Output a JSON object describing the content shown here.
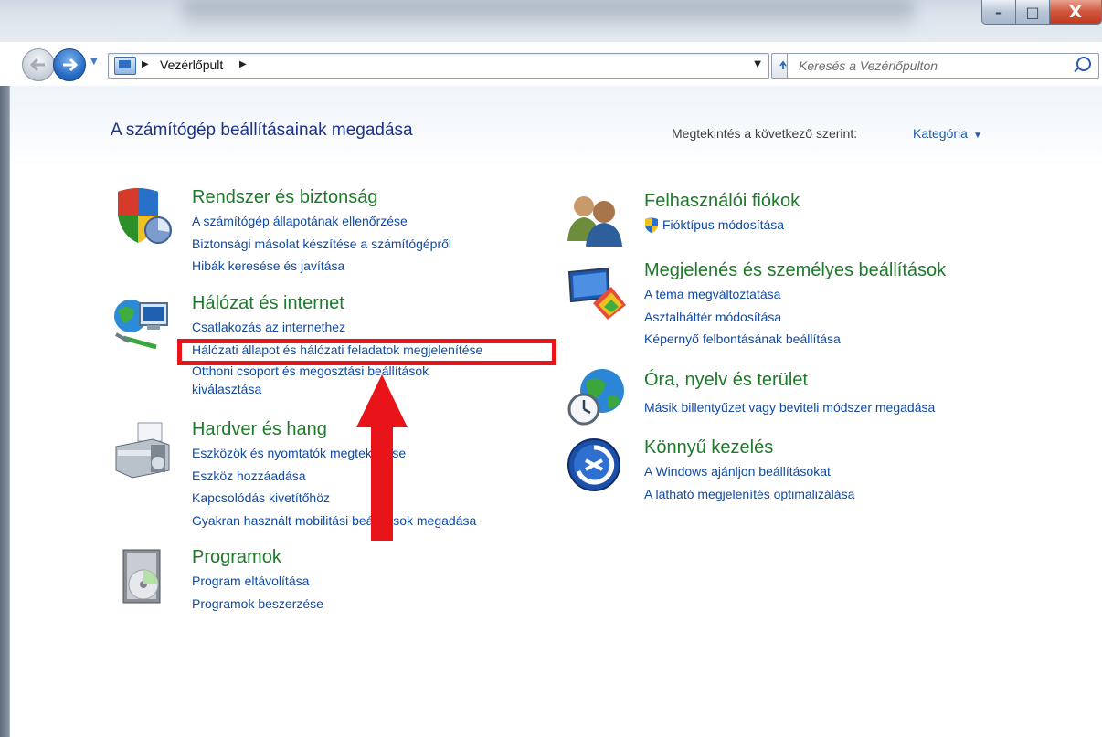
{
  "window": {
    "minimize": "–",
    "maximize": "□",
    "close": "X"
  },
  "address": {
    "crumbs": [
      "Vezérlőpult"
    ],
    "search_placeholder": "Keresés a Vezérlőpulton"
  },
  "header": {
    "title": "A számítógép beállításainak megadása",
    "view_by_label": "Megtekintés a következő szerint:",
    "view_by_value": "Kategória"
  },
  "left_categories": [
    {
      "title": "Rendszer és biztonság",
      "icon": "shield-icon",
      "links": [
        "A számítógép állapotának ellenőrzése",
        "Biztonsági másolat készítése a számítógépről",
        "Hibák keresése és javítása"
      ]
    },
    {
      "title": "Hálózat és internet",
      "icon": "network-icon",
      "links": [
        "Csatlakozás az internethez",
        "Hálózati állapot és hálózati feladatok megjelenítése",
        "Otthoni csoport és megosztási beállítások",
        "kiválasztása"
      ]
    },
    {
      "title": "Hardver és hang",
      "icon": "printer-icon",
      "links": [
        "Eszközök és nyomtatók megtekintése",
        "Eszköz hozzáadása",
        "Kapcsolódás kivetítőhöz",
        "Gyakran használt mobilitási beállítások megadása"
      ]
    },
    {
      "title": "Programok",
      "icon": "programs-icon",
      "links": [
        "Program eltávolítása",
        "Programok beszerzése"
      ]
    }
  ],
  "right_categories": [
    {
      "title": "Felhasználói fiókok",
      "icon": "users-icon",
      "links": [
        "Fióktípus módosítása"
      ]
    },
    {
      "title": "Megjelenés és személyes beállítások",
      "icon": "display-icon",
      "links": [
        "A téma megváltoztatása",
        "Asztalháttér módosítása",
        "Képernyő felbontásának beállítása"
      ]
    },
    {
      "title": "Óra, nyelv és terület",
      "icon": "clock-globe-icon",
      "links": [
        "Másik billentyűzet vagy beviteli módszer megadása"
      ]
    },
    {
      "title": "Könnyű kezelés",
      "icon": "ease-of-access-icon",
      "links": [
        "A Windows ajánljon beállításokat",
        "A látható megjelenítés optimalizálása"
      ]
    }
  ],
  "colors": {
    "link": "#0e4aa6",
    "category_title": "#1d7a2a",
    "highlight": "#e8141a"
  }
}
